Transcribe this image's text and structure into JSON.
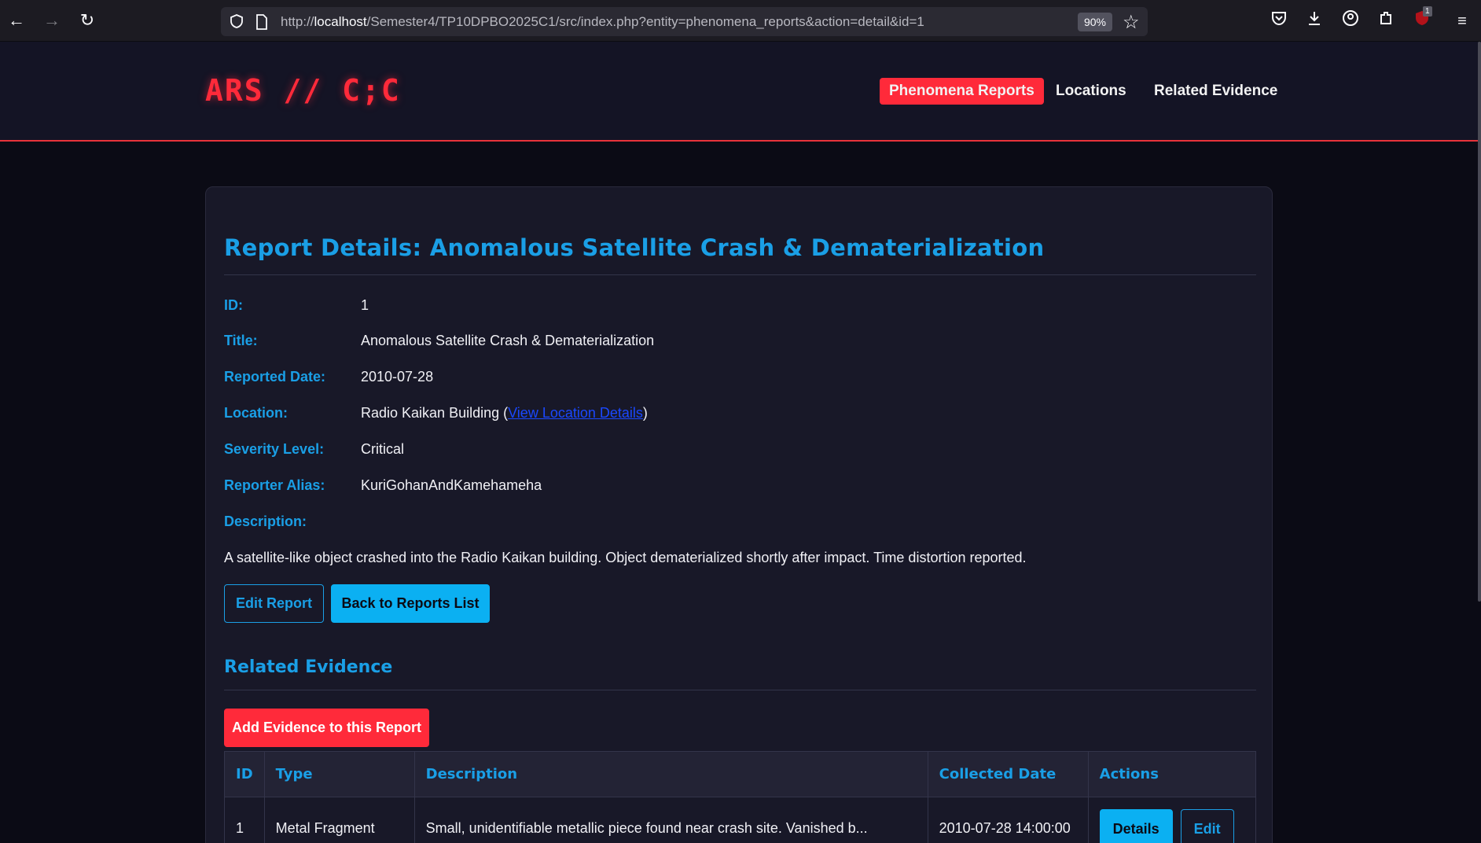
{
  "browser": {
    "url_prefix": "http://",
    "url_host": "localhost",
    "url_path": "/Semester4/TP10DPBO2025C1/src/index.php?entity=phenomena_reports&action=detail&id=1",
    "zoom": "90%",
    "ext_badge": "1"
  },
  "site": {
    "logo": "ARS // C;C",
    "nav": [
      "Phenomena Reports",
      "Locations",
      "Related Evidence"
    ]
  },
  "report": {
    "heading": "Report Details: Anomalous Satellite Crash & Dematerialization",
    "labels": {
      "id": "ID:",
      "title": "Title:",
      "date": "Reported Date:",
      "location": "Location:",
      "severity": "Severity Level:",
      "alias": "Reporter Alias:",
      "description": "Description:"
    },
    "id": "1",
    "title": "Anomalous Satellite Crash & Dematerialization",
    "date": "2010-07-28",
    "location": "Radio Kaikan Building (",
    "location_link": "View Location Details",
    "location_suffix": ")",
    "severity": "Critical",
    "alias": "KuriGohanAndKamehameha",
    "description": "A satellite-like object crashed into the Radio Kaikan building. Object dematerialized shortly after impact. Time distortion reported.",
    "edit_button": "Edit Report",
    "back_button": "Back to Reports List"
  },
  "evidence": {
    "heading": "Related Evidence",
    "add_button": "Add Evidence to this Report",
    "columns": [
      "ID",
      "Type",
      "Description",
      "Collected Date",
      "Actions"
    ],
    "rows": [
      {
        "id": "1",
        "type": "Metal Fragment",
        "description": "Small, unidentifiable metallic piece found near crash site. Vanished b...",
        "date": "2010-07-28 14:00:00",
        "details": "Details",
        "edit": "Edit"
      }
    ]
  }
}
